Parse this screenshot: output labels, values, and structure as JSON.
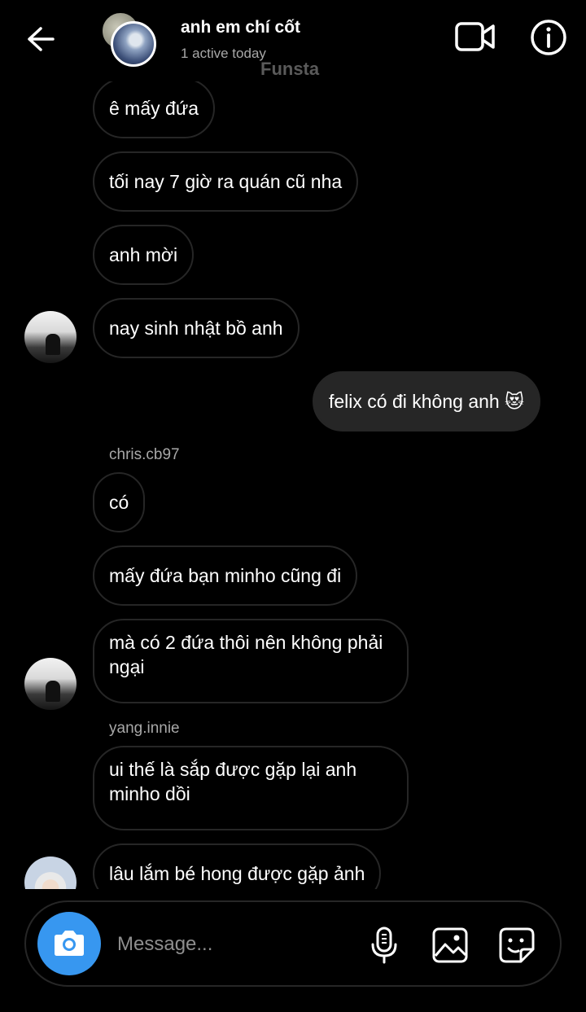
{
  "header": {
    "title": "anh em chí cốt",
    "status": "1 active today",
    "watermark": "Funsta"
  },
  "messages": [
    {
      "text": "ê mấy đứa"
    },
    {
      "text": "tối nay 7 giờ ra quán cũ nha"
    },
    {
      "text": "anh mời"
    },
    {
      "text": "nay sinh nhật bồ anh"
    },
    {
      "text": "felix có đi không anh 😻"
    },
    {
      "sender": "chris.cb97",
      "text": "có"
    },
    {
      "text": "mấy đứa bạn minho cũng đi"
    },
    {
      "text": "mà có 2 đứa thôi nên không phải ngại"
    },
    {
      "sender": "yang.innie",
      "text": "ui thế là sắp được gặp lại anh minho dồi"
    },
    {
      "text": "lâu lắm bé hong được gặp ảnh"
    }
  ],
  "composer": {
    "placeholder": "Message..."
  },
  "icons": {
    "back": "arrow-left-icon",
    "video": "video-camera-icon",
    "info": "info-icon",
    "camera": "camera-icon",
    "mic": "microphone-icon",
    "gallery": "image-icon",
    "sticker": "sticker-icon"
  },
  "colors": {
    "accent": "#3797f0",
    "own_bubble": "#262626",
    "background": "#000000"
  }
}
